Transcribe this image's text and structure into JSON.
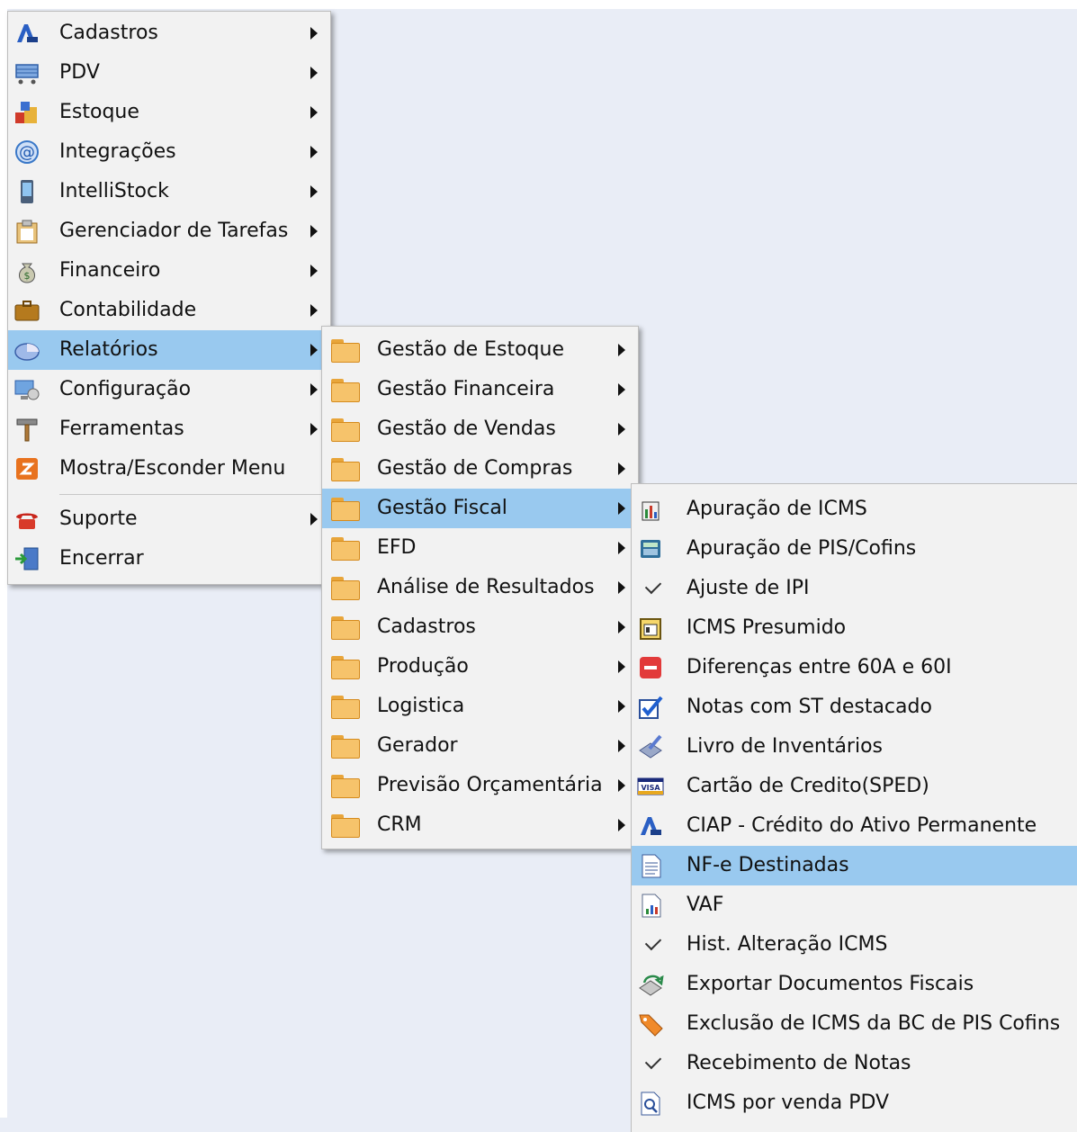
{
  "main_menu": {
    "items": [
      {
        "label": "Cadastros",
        "icon": "cadastros-icon",
        "submenu": true
      },
      {
        "label": "PDV",
        "icon": "pdv-cart-icon",
        "submenu": true
      },
      {
        "label": "Estoque",
        "icon": "estoque-icon",
        "submenu": true
      },
      {
        "label": "Integrações",
        "icon": "at-sign-icon",
        "submenu": true
      },
      {
        "label": "IntelliStock",
        "icon": "mobile-device-icon",
        "submenu": true
      },
      {
        "label": "Gerenciador de Tarefas",
        "icon": "clipboard-icon",
        "submenu": true
      },
      {
        "label": "Financeiro",
        "icon": "money-bag-icon",
        "submenu": true
      },
      {
        "label": "Contabilidade",
        "icon": "briefcase-icon",
        "submenu": true
      },
      {
        "label": "Relatórios",
        "icon": "reports-icon",
        "submenu": true,
        "highlighted": true
      },
      {
        "label": "Configuração",
        "icon": "settings-computer-icon",
        "submenu": true
      },
      {
        "label": "Ferramentas",
        "icon": "hammer-icon",
        "submenu": true
      },
      {
        "label": "Mostra/Esconder Menu",
        "icon": "toggle-menu-icon",
        "submenu": false
      },
      {
        "label": "Suporte",
        "icon": "telephone-icon",
        "submenu": true
      },
      {
        "label": "Encerrar",
        "icon": "exit-door-icon",
        "submenu": false
      }
    ]
  },
  "relatorios_menu": {
    "items": [
      {
        "label": "Gestão de Estoque"
      },
      {
        "label": "Gestão Financeira"
      },
      {
        "label": "Gestão de Vendas"
      },
      {
        "label": "Gestão de Compras"
      },
      {
        "label": "Gestão Fiscal",
        "highlighted": true
      },
      {
        "label": "EFD"
      },
      {
        "label": "Análise de Resultados"
      },
      {
        "label": "Cadastros"
      },
      {
        "label": "Produção"
      },
      {
        "label": "Logistica"
      },
      {
        "label": "Gerador"
      },
      {
        "label": "Previsão Orçamentária"
      },
      {
        "label": "CRM"
      }
    ]
  },
  "fiscal_menu": {
    "items": [
      {
        "label": "Apuração de ICMS",
        "icon": "building-chart-icon"
      },
      {
        "label": "Apuração de PIS/Cofins",
        "icon": "calculator-icon"
      },
      {
        "label": "Ajuste de IPI",
        "icon": "checkmark-icon"
      },
      {
        "label": "ICMS Presumido",
        "icon": "calendar-icon"
      },
      {
        "label": "Diferenças entre 60A e 60I",
        "icon": "minus-red-icon"
      },
      {
        "label": "Notas com ST destacado",
        "icon": "checkbox-checked-icon"
      },
      {
        "label": "Livro de Inventários",
        "icon": "pen-book-icon"
      },
      {
        "label": "Cartão de Credito(SPED)",
        "icon": "visa-card-icon"
      },
      {
        "label": "CIAP - Crédito do Ativo Permanente",
        "icon": "ciap-icon"
      },
      {
        "label": "NF-e Destinadas",
        "icon": "document-lines-icon",
        "highlighted": true
      },
      {
        "label": "VAF",
        "icon": "document-chart-icon"
      },
      {
        "label": "Hist. Alteração ICMS",
        "icon": "checkmark-icon"
      },
      {
        "label": "Exportar Documentos Fiscais",
        "icon": "export-arrow-icon"
      },
      {
        "label": "Exclusão de ICMS da BC de PIS Cofins",
        "icon": "tag-icon"
      },
      {
        "label": "Recebimento de Notas",
        "icon": "checkmark-icon"
      },
      {
        "label": "ICMS por venda PDV",
        "icon": "document-search-icon"
      }
    ]
  },
  "colors": {
    "highlight": "#99c9ef",
    "menu_bg": "#f2f2f2",
    "desktop_bg": "#e9edf6"
  }
}
